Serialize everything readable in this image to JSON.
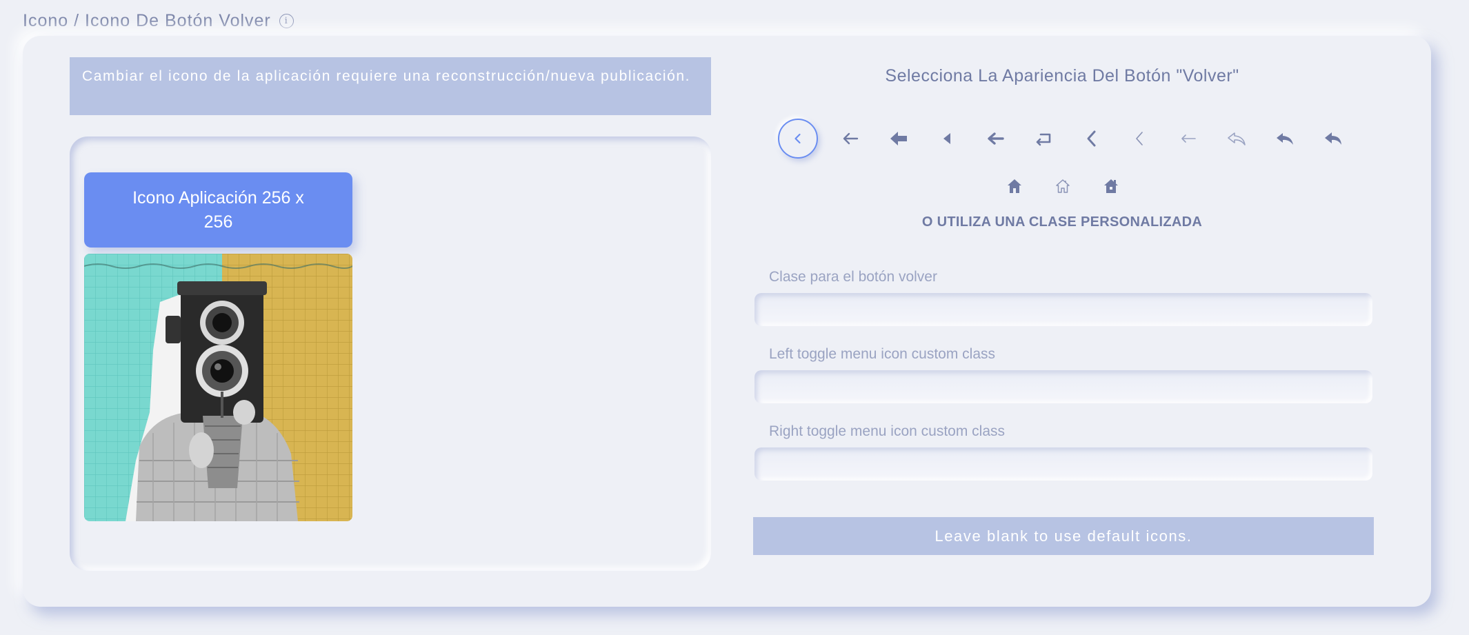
{
  "header": {
    "title": "Icono / Icono De Botón Volver",
    "info_icon": "info-icon"
  },
  "left": {
    "notice": "Cambiar el icono de la aplicación requiere una reconstrucción/nueva publicación.",
    "app_icon_button_label": "Icono Aplicación 256 x 256"
  },
  "right": {
    "section_title": "Selecciona La Apariencia Del Botón \"Volver\"",
    "back_icons": [
      "chevron-left-circle-icon",
      "arrow-left-icon",
      "arrow-left-bold-icon",
      "caret-left-icon",
      "arrow-left-thick-icon",
      "keyboard-return-icon",
      "chevron-left-bold-icon",
      "chevron-left-thin-icon",
      "arrow-left-light-icon",
      "reply-outline-icon",
      "reply-icon",
      "reply-bold-icon"
    ],
    "home_icons": [
      "home-icon",
      "home-outline-icon",
      "home-variant-icon"
    ],
    "selected_icon": "chevron-left-circle-icon",
    "alt_title": "O UTILIZA UNA CLASE PERSONALIZADA",
    "fields": {
      "back_class_label": "Clase para el botón volver",
      "back_class_value": "",
      "left_toggle_label": "Left toggle menu icon custom class",
      "left_toggle_value": "",
      "right_toggle_label": "Right toggle menu icon custom class",
      "right_toggle_value": ""
    },
    "hint": "Leave blank to use default icons."
  },
  "colors": {
    "accent": "#6a8df1",
    "notice_bg": "#b7c3e3",
    "page_bg": "#eef0f6",
    "text": "#6f7aa3"
  }
}
